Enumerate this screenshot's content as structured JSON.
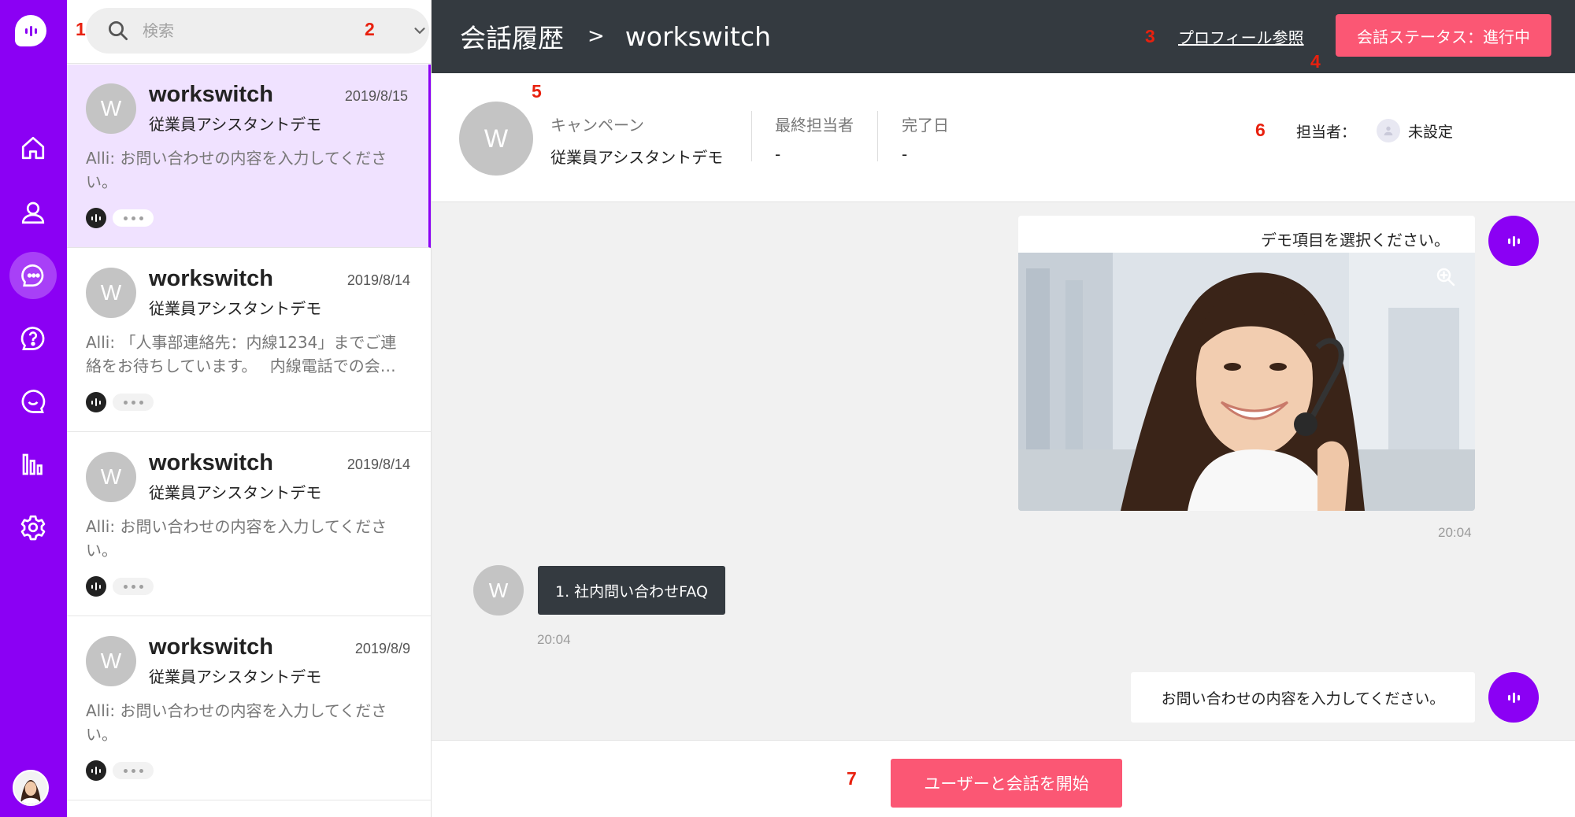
{
  "nav": {
    "items": [
      {
        "icon": "home-icon"
      },
      {
        "icon": "user-icon"
      },
      {
        "icon": "conversations-icon",
        "active": true
      },
      {
        "icon": "help-icon"
      },
      {
        "icon": "chat-icon"
      },
      {
        "icon": "analytics-icon"
      },
      {
        "icon": "settings-icon"
      }
    ]
  },
  "search": {
    "placeholder": "検索"
  },
  "conversations": [
    {
      "name": "workswitch",
      "date": "2019/8/15",
      "campaign": "従業員アシスタントデモ",
      "message": "Alli: お問い合わせの内容を入力してください。",
      "active": true
    },
    {
      "name": "workswitch",
      "date": "2019/8/14",
      "campaign": "従業員アシスタントデモ",
      "message": "Alli: 「人事部連絡先：内線1234」までご連絡をお待ちしています。　 内線電話での会…"
    },
    {
      "name": "workswitch",
      "date": "2019/8/14",
      "campaign": "従業員アシスタントデモ",
      "message": "Alli: お問い合わせの内容を入力してください。"
    },
    {
      "name": "workswitch",
      "date": "2019/8/9",
      "campaign": "従業員アシスタントデモ",
      "message": "Alli: お問い合わせの内容を入力してください。"
    }
  ],
  "header": {
    "title": "会話履歴",
    "separator": ">",
    "current": "workswitch",
    "profile_link": "プロフィール参照",
    "status_button": "会話ステータス：進行中"
  },
  "info": {
    "avatar_initial": "W",
    "campaign_label": "キャンペーン",
    "campaign_value": "従業員アシスタントデモ",
    "last_agent_label": "最終担当者",
    "last_agent_value": "-",
    "completed_label": "完了日",
    "completed_value": "-",
    "assignee_label": "担当者：",
    "assignee_value": "未設定"
  },
  "chat": {
    "card_text": "デモ項目を選択ください。",
    "card_time": "20:04",
    "user_initial": "W",
    "user_message": "1. 社内問い合わせFAQ",
    "user_time": "20:04",
    "bot_message": "お問い合わせの内容を入力してください。"
  },
  "footer": {
    "start_button": "ユーザーと会話を開始"
  },
  "annotations": [
    "1",
    "2",
    "3",
    "4",
    "5",
    "6",
    "7"
  ],
  "colors": {
    "brand": "#8b00f4",
    "accent": "#fb5774",
    "header": "#343a40"
  }
}
